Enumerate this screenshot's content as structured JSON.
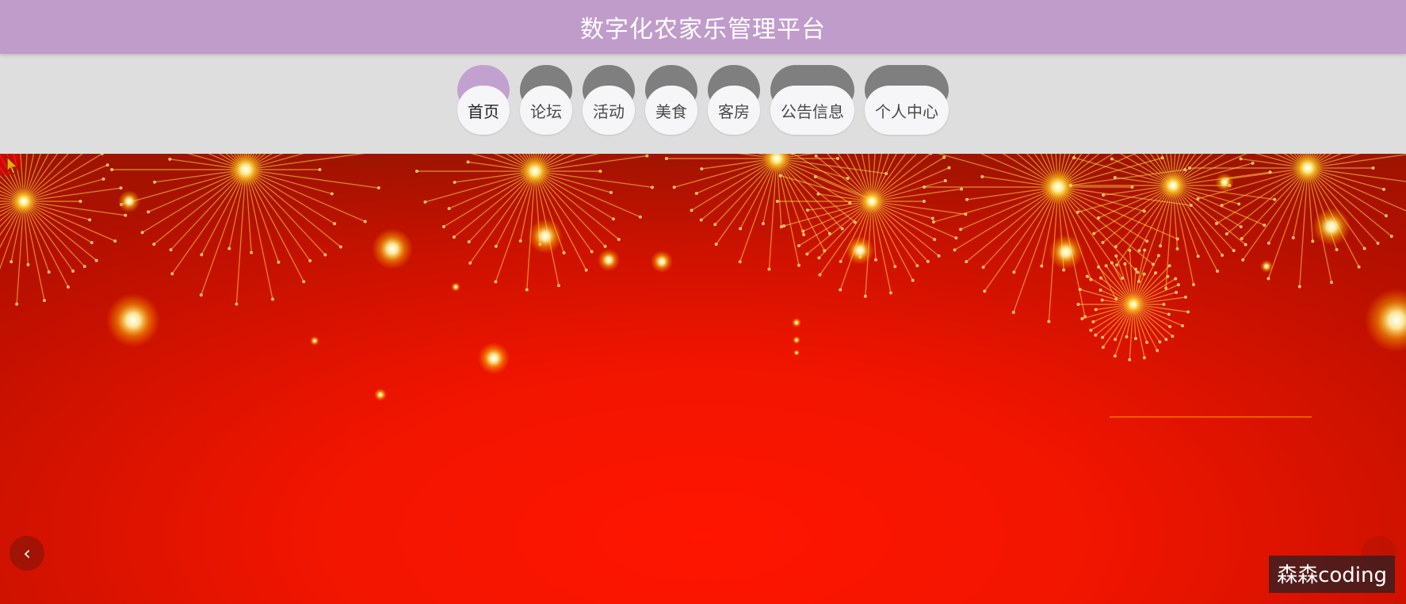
{
  "header": {
    "title": "数字化农家乐管理平台"
  },
  "nav": {
    "items": [
      {
        "label": "首页",
        "active": true
      },
      {
        "label": "论坛",
        "active": false
      },
      {
        "label": "活动",
        "active": false
      },
      {
        "label": "美食",
        "active": false
      },
      {
        "label": "客房",
        "active": false
      },
      {
        "label": "公告信息",
        "active": false
      },
      {
        "label": "个人中心",
        "active": false
      }
    ]
  },
  "banner": {
    "prev_icon": "chevron-left-icon",
    "next_icon": "chevron-right-icon",
    "background": "fireworks-on-red"
  },
  "watermark": {
    "text": "森森coding"
  },
  "colors": {
    "title_bar": "#c09ccb",
    "nav_active": "#c3a1cf",
    "nav_inactive": "#7f7f7f",
    "banner_red": "#f21500"
  }
}
